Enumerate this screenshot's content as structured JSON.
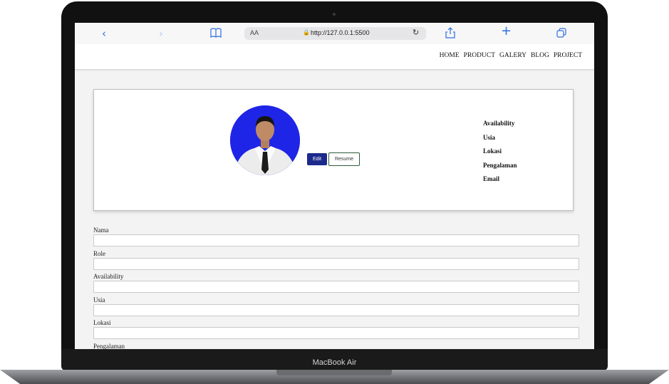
{
  "browser": {
    "nav_back_icon": "chevron-left-icon",
    "nav_forward_icon": "chevron-right-icon",
    "bookmarks_icon": "book-icon",
    "text_size_label": "AA",
    "lock_icon": "lock-icon",
    "url": "http://127.0.0.1:5500",
    "reload_icon": "reload-icon",
    "share_icon": "share-icon",
    "new_tab_icon": "plus-icon",
    "tabs_icon": "tabs-icon",
    "accent_color": "#2f6fe0"
  },
  "site_nav": {
    "items": [
      {
        "label": "HOME"
      },
      {
        "label": "PRODUCT"
      },
      {
        "label": "GALERY"
      },
      {
        "label": "BLOG"
      },
      {
        "label": "PROJECT"
      }
    ]
  },
  "profile": {
    "edit_label": "Edit",
    "resume_label": "Resume",
    "avatar_background": "#1f25e6",
    "edit_button_color": "#1c2a8c",
    "info_labels": [
      "Availability",
      "Usia",
      "Lokasi",
      "Pengalaman",
      "Email"
    ]
  },
  "form": {
    "fields": [
      {
        "label": "Nama",
        "value": ""
      },
      {
        "label": "Role",
        "value": ""
      },
      {
        "label": "Availability",
        "value": ""
      },
      {
        "label": "Usia",
        "value": ""
      },
      {
        "label": "Lokasi",
        "value": ""
      },
      {
        "label": "Pengalaman",
        "value": ""
      }
    ]
  },
  "device": {
    "brand_label": "MacBook Air"
  }
}
